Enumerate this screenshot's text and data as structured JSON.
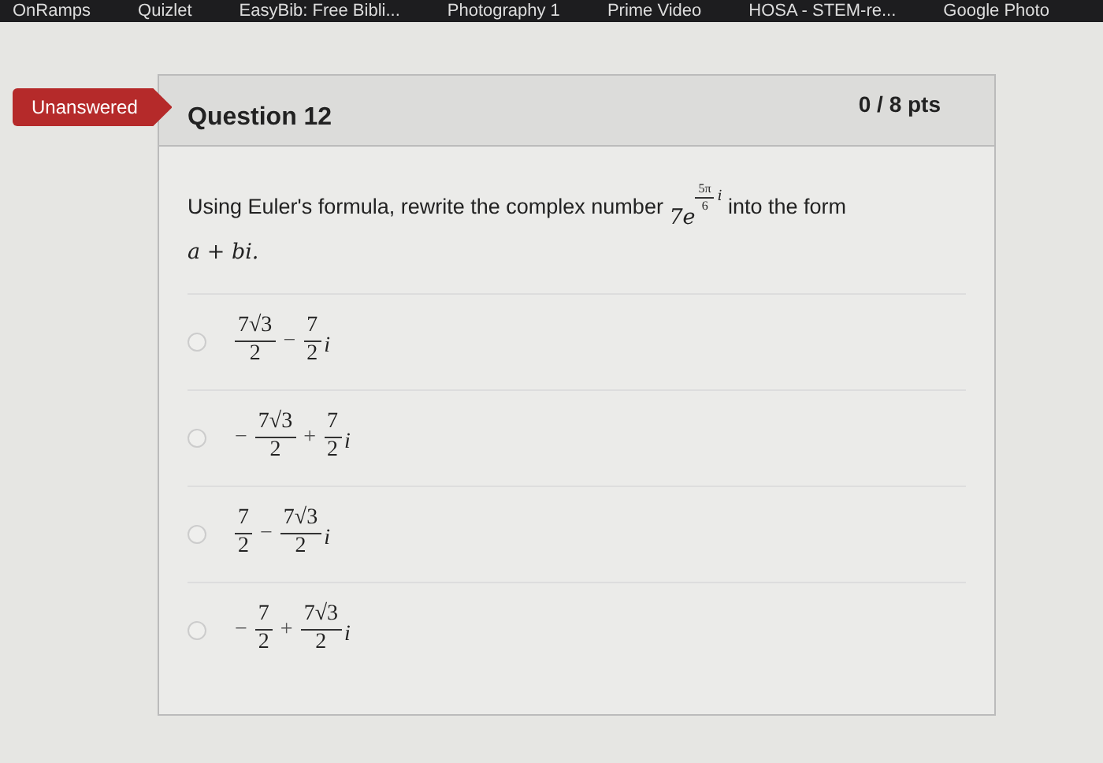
{
  "bookmarks": [
    {
      "label": "OnRamps"
    },
    {
      "label": "Quizlet"
    },
    {
      "label": "EasyBib: Free Bibli..."
    },
    {
      "label": "Photography 1"
    },
    {
      "label": "Prime Video"
    },
    {
      "label": "HOSA - STEM-re..."
    },
    {
      "label": "Google Photo"
    }
  ],
  "status_badge": "Unanswered",
  "question": {
    "title": "Question 12",
    "points": "0 / 8 pts",
    "before": "Using Euler's formula, rewrite the complex number",
    "base": "7e",
    "exp_num": "5π",
    "exp_den": "6",
    "exp_unit": "i",
    "after": "into the form",
    "form": "a + bi."
  },
  "options": [
    {
      "selected": false,
      "terms": [
        {
          "num": "7√3",
          "den": "2"
        },
        {
          "sign": "−",
          "num": "7",
          "den": "2",
          "unit": "i"
        }
      ]
    },
    {
      "selected": false,
      "terms": [
        {
          "sign": "−",
          "num": "7√3",
          "den": "2"
        },
        {
          "sign": "+",
          "num": "7",
          "den": "2",
          "unit": "i"
        }
      ]
    },
    {
      "selected": false,
      "terms": [
        {
          "num": "7",
          "den": "2"
        },
        {
          "sign": "−",
          "num": "7√3",
          "den": "2",
          "unit": "i"
        }
      ]
    },
    {
      "selected": false,
      "terms": [
        {
          "sign": "−",
          "num": "7",
          "den": "2"
        },
        {
          "sign": "+",
          "num": "7√3",
          "den": "2",
          "unit": "i"
        }
      ]
    }
  ]
}
